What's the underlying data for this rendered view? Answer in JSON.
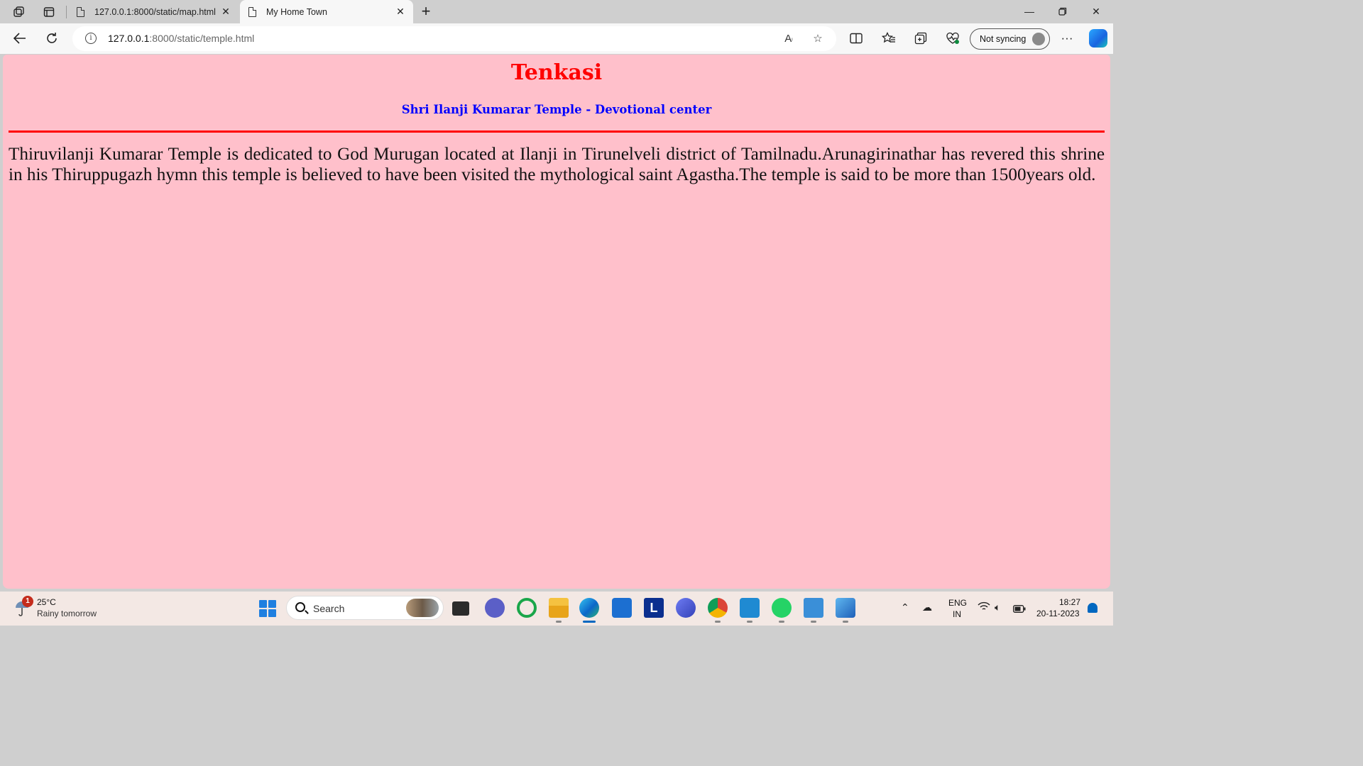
{
  "browser": {
    "tabs": [
      {
        "title": "127.0.0.1:8000/static/map.html",
        "active": false
      },
      {
        "title": "My Home Town",
        "active": true
      }
    ],
    "url_host": "127.0.0.1",
    "url_path": ":8000/static/temple.html",
    "sync_label": "Not syncing",
    "icons": {
      "workspaces": "workspaces-icon",
      "tab_actions": "tab-actions-icon",
      "back": "back-arrow-icon",
      "refresh": "refresh-icon",
      "info": "info-icon",
      "read_aloud": "read-aloud-icon",
      "favorite": "star-icon",
      "split_screen": "split-screen-icon",
      "favorites": "favorites-icon",
      "collections": "collections-icon",
      "browser_essentials": "heart-pulse-icon",
      "more": "more-icon",
      "copilot": "copilot-icon"
    }
  },
  "page": {
    "heading": "Tenkasi",
    "subheading": "Shri Ilanji Kumarar Temple - Devotional center",
    "paragraph": "Thiruvilanji Kumarar Temple is dedicated to God Murugan located at Ilanji in Tirunelveli district of Tamilnadu.Arunagirinathar has revered this shrine in his Thiruppugazh hymn this temple is believed to have been visited the mythological saint Agastha.The temple is said to be more than 1500years old.",
    "colors": {
      "background": "#ffc0cb",
      "heading": "#ff0000",
      "subheading": "#0000ff",
      "rule": "#ff0000"
    }
  },
  "taskbar": {
    "weather_temp": "25°C",
    "weather_desc": "Rainy tomorrow",
    "weather_badge": "1",
    "search_placeholder": "Search",
    "language_top": "ENG",
    "language_bottom": "IN",
    "time": "18:27",
    "date": "20-11-2023",
    "apps": [
      "task-view-icon",
      "teams-icon",
      "loading-ring-icon",
      "file-explorer-icon",
      "edge-icon",
      "store-icon",
      "l-app-icon",
      "arc-app-icon",
      "chrome-icon",
      "vscode-icon",
      "whatsapp-icon",
      "notepad-icon",
      "paint-icon"
    ]
  }
}
